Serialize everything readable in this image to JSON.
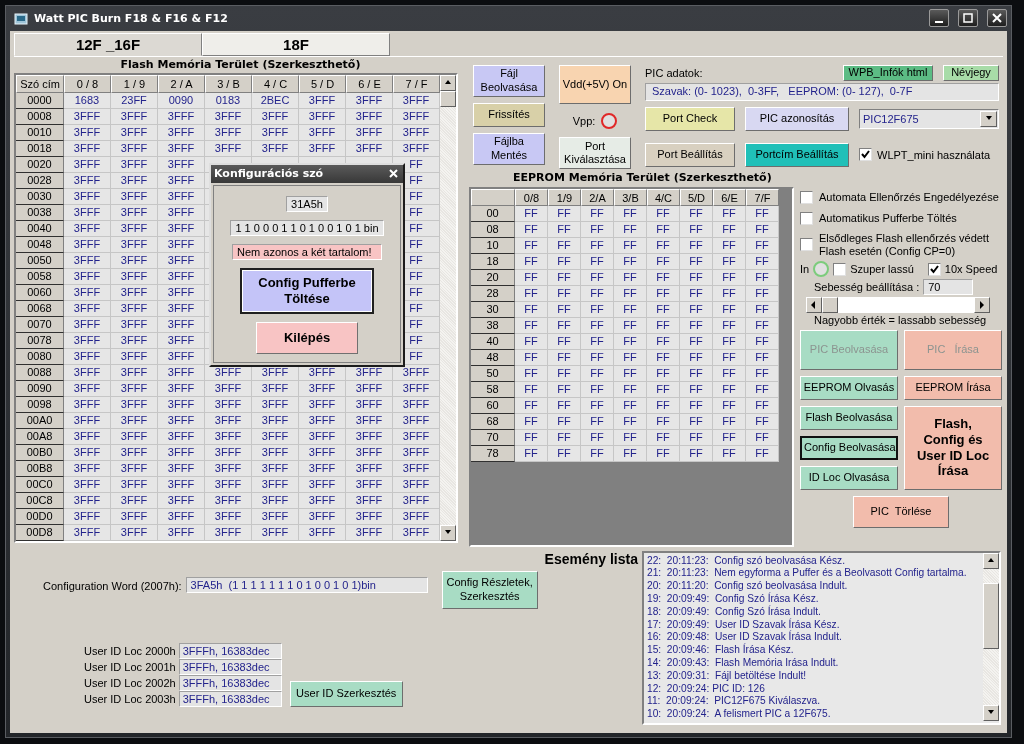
{
  "window": {
    "title": "Watt PIC Burn F18 & F16 & F12"
  },
  "tabs": [
    {
      "label": "12F _16F",
      "selected": true
    },
    {
      "label": "18F",
      "selected": false
    }
  ],
  "flash": {
    "title": "Flash Memória Terület (Szerkeszthető)",
    "columns": [
      "Szó cím",
      "0 / 8",
      "1 / 9",
      "2 / A",
      "3 / B",
      "4 / C",
      "5 / D",
      "6 / E",
      "7 / F"
    ],
    "rows": [
      [
        "0000",
        "1683",
        "23FF",
        "0090",
        "0183",
        "2BEC",
        "3FFF",
        "3FFF",
        "3FFF"
      ],
      [
        "0008",
        "3FFF",
        "3FFF",
        "3FFF",
        "3FFF",
        "3FFF",
        "3FFF",
        "3FFF",
        "3FFF"
      ],
      [
        "0010",
        "3FFF",
        "3FFF",
        "3FFF",
        "3FFF",
        "3FFF",
        "3FFF",
        "3FFF",
        "3FFF"
      ],
      [
        "0018",
        "3FFF",
        "3FFF",
        "3FFF",
        "3FFF",
        "3FFF",
        "3FFF",
        "3FFF",
        "3FFF"
      ],
      [
        "0020",
        "3FFF",
        "3FFF",
        "3FFF",
        null,
        null,
        null,
        null,
        "FF"
      ],
      [
        "0028",
        "3FFF",
        "3FFF",
        "3FFF",
        null,
        null,
        null,
        null,
        "FF"
      ],
      [
        "0030",
        "3FFF",
        "3FFF",
        "3FFF",
        null,
        null,
        null,
        null,
        "FF"
      ],
      [
        "0038",
        "3FFF",
        "3FFF",
        "3FFF",
        null,
        null,
        null,
        null,
        "FF"
      ],
      [
        "0040",
        "3FFF",
        "3FFF",
        "3FFF",
        null,
        null,
        null,
        null,
        "FF"
      ],
      [
        "0048",
        "3FFF",
        "3FFF",
        "3FFF",
        null,
        null,
        null,
        null,
        "FF"
      ],
      [
        "0050",
        "3FFF",
        "3FFF",
        "3FFF",
        null,
        null,
        null,
        null,
        "FF"
      ],
      [
        "0058",
        "3FFF",
        "3FFF",
        "3FFF",
        null,
        null,
        null,
        null,
        "FF"
      ],
      [
        "0060",
        "3FFF",
        "3FFF",
        "3FFF",
        null,
        null,
        null,
        null,
        "FF"
      ],
      [
        "0068",
        "3FFF",
        "3FFF",
        "3FFF",
        null,
        null,
        null,
        null,
        "FF"
      ],
      [
        "0070",
        "3FFF",
        "3FFF",
        "3FFF",
        null,
        null,
        null,
        null,
        "FF"
      ],
      [
        "0078",
        "3FFF",
        "3FFF",
        "3FFF",
        null,
        null,
        null,
        null,
        "FF"
      ],
      [
        "0080",
        "3FFF",
        "3FFF",
        "3FFF",
        null,
        null,
        null,
        null,
        "FF"
      ],
      [
        "0088",
        "3FFF",
        "3FFF",
        "3FFF",
        "3FFF",
        "3FFF",
        "3FFF",
        "3FFF",
        "3FFF"
      ],
      [
        "0090",
        "3FFF",
        "3FFF",
        "3FFF",
        "3FFF",
        "3FFF",
        "3FFF",
        "3FFF",
        "3FFF"
      ],
      [
        "0098",
        "3FFF",
        "3FFF",
        "3FFF",
        "3FFF",
        "3FFF",
        "3FFF",
        "3FFF",
        "3FFF"
      ],
      [
        "00A0",
        "3FFF",
        "3FFF",
        "3FFF",
        "3FFF",
        "3FFF",
        "3FFF",
        "3FFF",
        "3FFF"
      ],
      [
        "00A8",
        "3FFF",
        "3FFF",
        "3FFF",
        "3FFF",
        "3FFF",
        "3FFF",
        "3FFF",
        "3FFF"
      ],
      [
        "00B0",
        "3FFF",
        "3FFF",
        "3FFF",
        "3FFF",
        "3FFF",
        "3FFF",
        "3FFF",
        "3FFF"
      ],
      [
        "00B8",
        "3FFF",
        "3FFF",
        "3FFF",
        "3FFF",
        "3FFF",
        "3FFF",
        "3FFF",
        "3FFF"
      ],
      [
        "00C0",
        "3FFF",
        "3FFF",
        "3FFF",
        "3FFF",
        "3FFF",
        "3FFF",
        "3FFF",
        "3FFF"
      ],
      [
        "00C8",
        "3FFF",
        "3FFF",
        "3FFF",
        "3FFF",
        "3FFF",
        "3FFF",
        "3FFF",
        "3FFF"
      ],
      [
        "00D0",
        "3FFF",
        "3FFF",
        "3FFF",
        "3FFF",
        "3FFF",
        "3FFF",
        "3FFF",
        "3FFF"
      ],
      [
        "00D8",
        "3FFF",
        "3FFF",
        "3FFF",
        "3FFF",
        "3FFF",
        "3FFF",
        "3FFF",
        "3FFF"
      ]
    ]
  },
  "dialog": {
    "title": "Konfigurációs szó",
    "hex": "31A5h",
    "bin": "1 1 0 0 0 1 1 0 1 0 0 1 0 1 bin",
    "message": "Nem azonos a két tartalom!",
    "buttons": [
      {
        "label": "Config Pufferbe\nTöltése",
        "kind": "primary"
      },
      {
        "label": "Kilépés",
        "kind": "cancel"
      }
    ]
  },
  "file_buttons": [
    {
      "label": "Fájl\nBeolvasása",
      "color": "#c8c8f4"
    },
    {
      "label": "Frissítés",
      "color": "#d8d0a8"
    },
    {
      "label": "Fájlba\nMentés",
      "color": "#c8c8f4"
    }
  ],
  "power_buttons": [
    {
      "label": "Vdd(+5V) On",
      "color": "#f8d4b0"
    },
    {
      "label": "Port\nKiválasztása",
      "color": "#e6ece6"
    }
  ],
  "vpp_label": "Vpp:",
  "pic_data": {
    "label": "PIC adatok:",
    "info": "Szavak: (0- 1023),  0-3FF,   EEPROM: (0- 127),  0-7F",
    "links": [
      {
        "label": "WPB_Infók html",
        "color": "#5cbc84"
      },
      {
        "label": "Névjegy",
        "color": "#a8dca8"
      }
    ]
  },
  "port_buttons": [
    {
      "label": "Port Check",
      "color": "#e6e6a8"
    },
    {
      "label": "PIC azonosítás",
      "color": "#d8d8f2"
    },
    {
      "label": "Port Beállítás",
      "color": "#d8d0c0"
    },
    {
      "label": "Portcím Beállítás",
      "color": "#20c0b8"
    }
  ],
  "device_select": {
    "value": "PIC12F675"
  },
  "wlpt": {
    "label": "WLPT_mini használata",
    "checked": true
  },
  "eeprom": {
    "title": "EEPROM Memória Terület (Szerkeszthető)",
    "columns": [
      "",
      "0/8",
      "1/9",
      "2/A",
      "3/B",
      "4/C",
      "5/D",
      "6/E",
      "7/F"
    ],
    "rows": [
      [
        "00",
        "FF",
        "FF",
        "FF",
        "FF",
        "FF",
        "FF",
        "FF",
        "FF"
      ],
      [
        "08",
        "FF",
        "FF",
        "FF",
        "FF",
        "FF",
        "FF",
        "FF",
        "FF"
      ],
      [
        "10",
        "FF",
        "FF",
        "FF",
        "FF",
        "FF",
        "FF",
        "FF",
        "FF"
      ],
      [
        "18",
        "FF",
        "FF",
        "FF",
        "FF",
        "FF",
        "FF",
        "FF",
        "FF"
      ],
      [
        "20",
        "FF",
        "FF",
        "FF",
        "FF",
        "FF",
        "FF",
        "FF",
        "FF"
      ],
      [
        "28",
        "FF",
        "FF",
        "FF",
        "FF",
        "FF",
        "FF",
        "FF",
        "FF"
      ],
      [
        "30",
        "FF",
        "FF",
        "FF",
        "FF",
        "FF",
        "FF",
        "FF",
        "FF"
      ],
      [
        "38",
        "FF",
        "FF",
        "FF",
        "FF",
        "FF",
        "FF",
        "FF",
        "FF"
      ],
      [
        "40",
        "FF",
        "FF",
        "FF",
        "FF",
        "FF",
        "FF",
        "FF",
        "FF"
      ],
      [
        "48",
        "FF",
        "FF",
        "FF",
        "FF",
        "FF",
        "FF",
        "FF",
        "FF"
      ],
      [
        "50",
        "FF",
        "FF",
        "FF",
        "FF",
        "FF",
        "FF",
        "FF",
        "FF"
      ],
      [
        "58",
        "FF",
        "FF",
        "FF",
        "FF",
        "FF",
        "FF",
        "FF",
        "FF"
      ],
      [
        "60",
        "FF",
        "FF",
        "FF",
        "FF",
        "FF",
        "FF",
        "FF",
        "FF"
      ],
      [
        "68",
        "FF",
        "FF",
        "FF",
        "FF",
        "FF",
        "FF",
        "FF",
        "FF"
      ],
      [
        "70",
        "FF",
        "FF",
        "FF",
        "FF",
        "FF",
        "FF",
        "FF",
        "FF"
      ],
      [
        "78",
        "FF",
        "FF",
        "FF",
        "FF",
        "FF",
        "FF",
        "FF",
        "FF"
      ]
    ]
  },
  "options": [
    {
      "label": "Automata Ellenőrzés Engedélyezése",
      "checked": false
    },
    {
      "label": "Automatikus Pufferbe Töltés",
      "checked": false
    },
    {
      "label": "Elsődleges Flash ellenőrzés védett\nFlash esetén (Config CP=0)",
      "checked": false
    }
  ],
  "speed": {
    "in_label": "In",
    "slow": {
      "label": "Szuper lassú",
      "checked": false
    },
    "fast": {
      "label": "10x Speed",
      "checked": true
    },
    "label": "Sebesség beállítása :",
    "value": "70",
    "level": 0,
    "hint": "Nagyobb érték = lassabb sebesség"
  },
  "actions": [
    {
      "label": "PIC Beolvasása",
      "color": "#a8dcc4",
      "kind": "normal",
      "disabled": true,
      "focused": false
    },
    {
      "label": "PIC   Írása",
      "color": "#f2bcac",
      "kind": "normal",
      "disabled": true,
      "focused": false
    },
    {
      "label": "EEPROM Olvasás",
      "color": "#a8dcc4",
      "kind": "normal",
      "disabled": false,
      "focused": false
    },
    {
      "label": "EEPROM Írása",
      "color": "#f2bcac",
      "kind": "normal",
      "disabled": false,
      "focused": false
    },
    {
      "label": "Flash Beolvasása",
      "color": "#a8dcc4",
      "kind": "normal",
      "disabled": false,
      "focused": false
    },
    {
      "label": "Config Beolvasása",
      "color": "#a8dcc4",
      "kind": "normal",
      "disabled": false,
      "focused": true
    },
    {
      "label": "ID Loc Olvasása",
      "color": "#a8dcc4",
      "kind": "normal",
      "disabled": false,
      "focused": false
    },
    {
      "label": "Flash,\nConfig és\nUser ID Loc\nÍrása",
      "color": "#f2bcac",
      "kind": "emphasized",
      "disabled": false,
      "focused": false
    },
    {
      "label": "PIC  Törlése",
      "color": "#f2bcac",
      "kind": "normal",
      "disabled": false,
      "focused": false
    }
  ],
  "config_word": {
    "label": "Configuration Word (2007h):",
    "value": "3FA5h  (1 1 1 1 1 1 1 0 1 0 0 1 0 1)bin",
    "button": "Config Részletek,\nSzerkesztés"
  },
  "user_ids": [
    {
      "label": "User ID Loc 2000h",
      "value": "3FFFh, 16383dec"
    },
    {
      "label": "User ID Loc 2001h",
      "value": "3FFFh, 16383dec"
    },
    {
      "label": "User ID Loc 2002h",
      "value": "3FFFh, 16383dec"
    },
    {
      "label": "User ID Loc 2003h",
      "value": "3FFFh, 16383dec"
    }
  ],
  "user_id_button": "User ID Szerkesztés",
  "events": {
    "title": "Esemény lista",
    "items": [
      "22:  20:11:23:  Config szó beolvasása Kész.",
      "21:  20:11:23:  Nem egyforma a Puffer és a Beolvasott Config tartalma.",
      "20:  20:11:20:  Config szó beolvasása Indult.",
      "19:  20:09:49:  Config Szó Írása Kész.",
      "18:  20:09:49:  Config Szó Írása Indult.",
      "17:  20:09:49:  User ID Szavak Írása Kész.",
      "16:  20:09:48:  User ID Szavak Írása Indult.",
      "15:  20:09:46:  Flash Írása Kész.",
      "14:  20:09:43:  Flash Memória Irása Indult.",
      "13:  20:09:31:  Fájl betöltése Indult!",
      "12:  20:09:24: PIC ID: 126",
      "11:  20:09:24:  PIC12F675 Kiválaszva.",
      "10:  20:09:24:  A felismert PIC a 12F675."
    ]
  }
}
